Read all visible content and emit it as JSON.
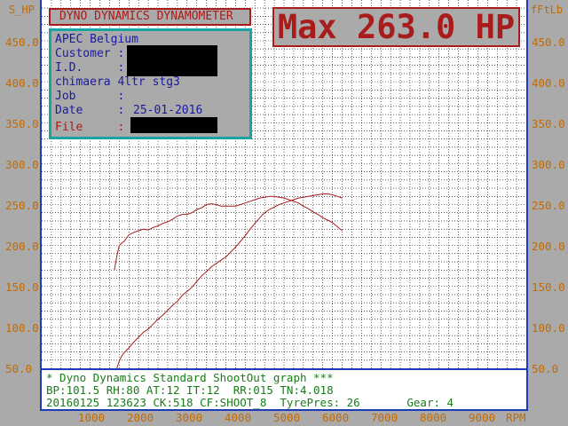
{
  "axes": {
    "left_label": "S_HP",
    "right_label": "fFtLb",
    "rpm_label": "RPM"
  },
  "title_box": {
    "text": "DYNO DYNAMICS DYNAMOMETER"
  },
  "max_box": {
    "text": "Max 263.0 HP"
  },
  "info": {
    "company": "APEC Belgium",
    "customer_label": "Customer :",
    "id_label": "I.D.     :",
    "vehicle": "chimaera 4ltr stg3",
    "job_label": "Job      :",
    "date_label": "Date     :",
    "date_value": "25-01-2016",
    "file_label": "File     :"
  },
  "footer": {
    "line1": "* Dyno Dynamics Standard ShootOut graph ***",
    "line2": "BP:101.5 RH:80 AT:12 IT:12  RR:015 TN:4.018",
    "line3": "20160125 123623 CK:518 CF:SHOOT_8  TyrePres: 26       Gear: 4"
  },
  "colors": {
    "curve": "#a81c1c",
    "grid": "#000000",
    "frame": "#1f3cb8",
    "tick_text": "#c46a00"
  },
  "chart_data": {
    "type": "line",
    "title": "Max 263.0 HP",
    "xlabel": "RPM",
    "ylabel": "S_HP",
    "y2label": "fFtLb",
    "xlim": [
      0,
      10000
    ],
    "ylim": [
      50,
      450
    ],
    "y_ticks": [
      "50.0",
      "100.0",
      "150.0",
      "200.0",
      "250.0",
      "300.0",
      "350.0",
      "400.0",
      "450.0"
    ],
    "x_ticks": [
      "1000",
      "2000",
      "3000",
      "4000",
      "5000",
      "6000",
      "7000",
      "8000",
      "9000"
    ],
    "grid": true,
    "series": [
      {
        "x": [
          1550,
          1600,
          1650,
          1700,
          1800,
          1900,
          2000,
          2100,
          2200,
          2300,
          2400,
          2500,
          2600,
          2700,
          2800,
          2900,
          3000,
          3100,
          3200,
          3300,
          3400,
          3500,
          3600,
          3700,
          3800,
          3900,
          4000,
          4100,
          4200,
          4300,
          4400,
          4500,
          4600,
          4700,
          4800,
          4900,
          5000,
          5100,
          5200,
          5300,
          5400,
          5500,
          5600,
          5700,
          5800,
          5900,
          6000,
          6100,
          6200
        ],
        "values": [
          50,
          59,
          65,
          69,
          75,
          82,
          88,
          94,
          98,
          104,
          110,
          115,
          121,
          127,
          132,
          139,
          144,
          149,
          156,
          163,
          168,
          174,
          178,
          182,
          186,
          192,
          198,
          205,
          212,
          220,
          227,
          234,
          240,
          244,
          247,
          250,
          252,
          254,
          256,
          258,
          259,
          260,
          261,
          262,
          263,
          263,
          262,
          260,
          258
        ]
      },
      {
        "x": [
          1500,
          1550,
          1600,
          1650,
          1700,
          1800,
          1900,
          2000,
          2100,
          2200,
          2300,
          2400,
          2500,
          2600,
          2700,
          2800,
          2900,
          3000,
          3100,
          3200,
          3300,
          3400,
          3500,
          3600,
          3700,
          3800,
          3900,
          4000,
          4100,
          4200,
          4300,
          4400,
          4500,
          4600,
          4700,
          4800,
          4900,
          5000,
          5100,
          5200,
          5300,
          5400,
          5500,
          5600,
          5700,
          5800,
          5900,
          6000,
          6100,
          6200
        ],
        "values": [
          170,
          187,
          200,
          203,
          205,
          213,
          216,
          218,
          220,
          219,
          222,
          224,
          227,
          229,
          232,
          236,
          238,
          238,
          240,
          244,
          246,
          250,
          251,
          250,
          248,
          248,
          248,
          248,
          250,
          252,
          254,
          256,
          258,
          259,
          260,
          260,
          259,
          258,
          256,
          254,
          252,
          248,
          245,
          241,
          238,
          234,
          231,
          228,
          223,
          218
        ]
      }
    ]
  }
}
